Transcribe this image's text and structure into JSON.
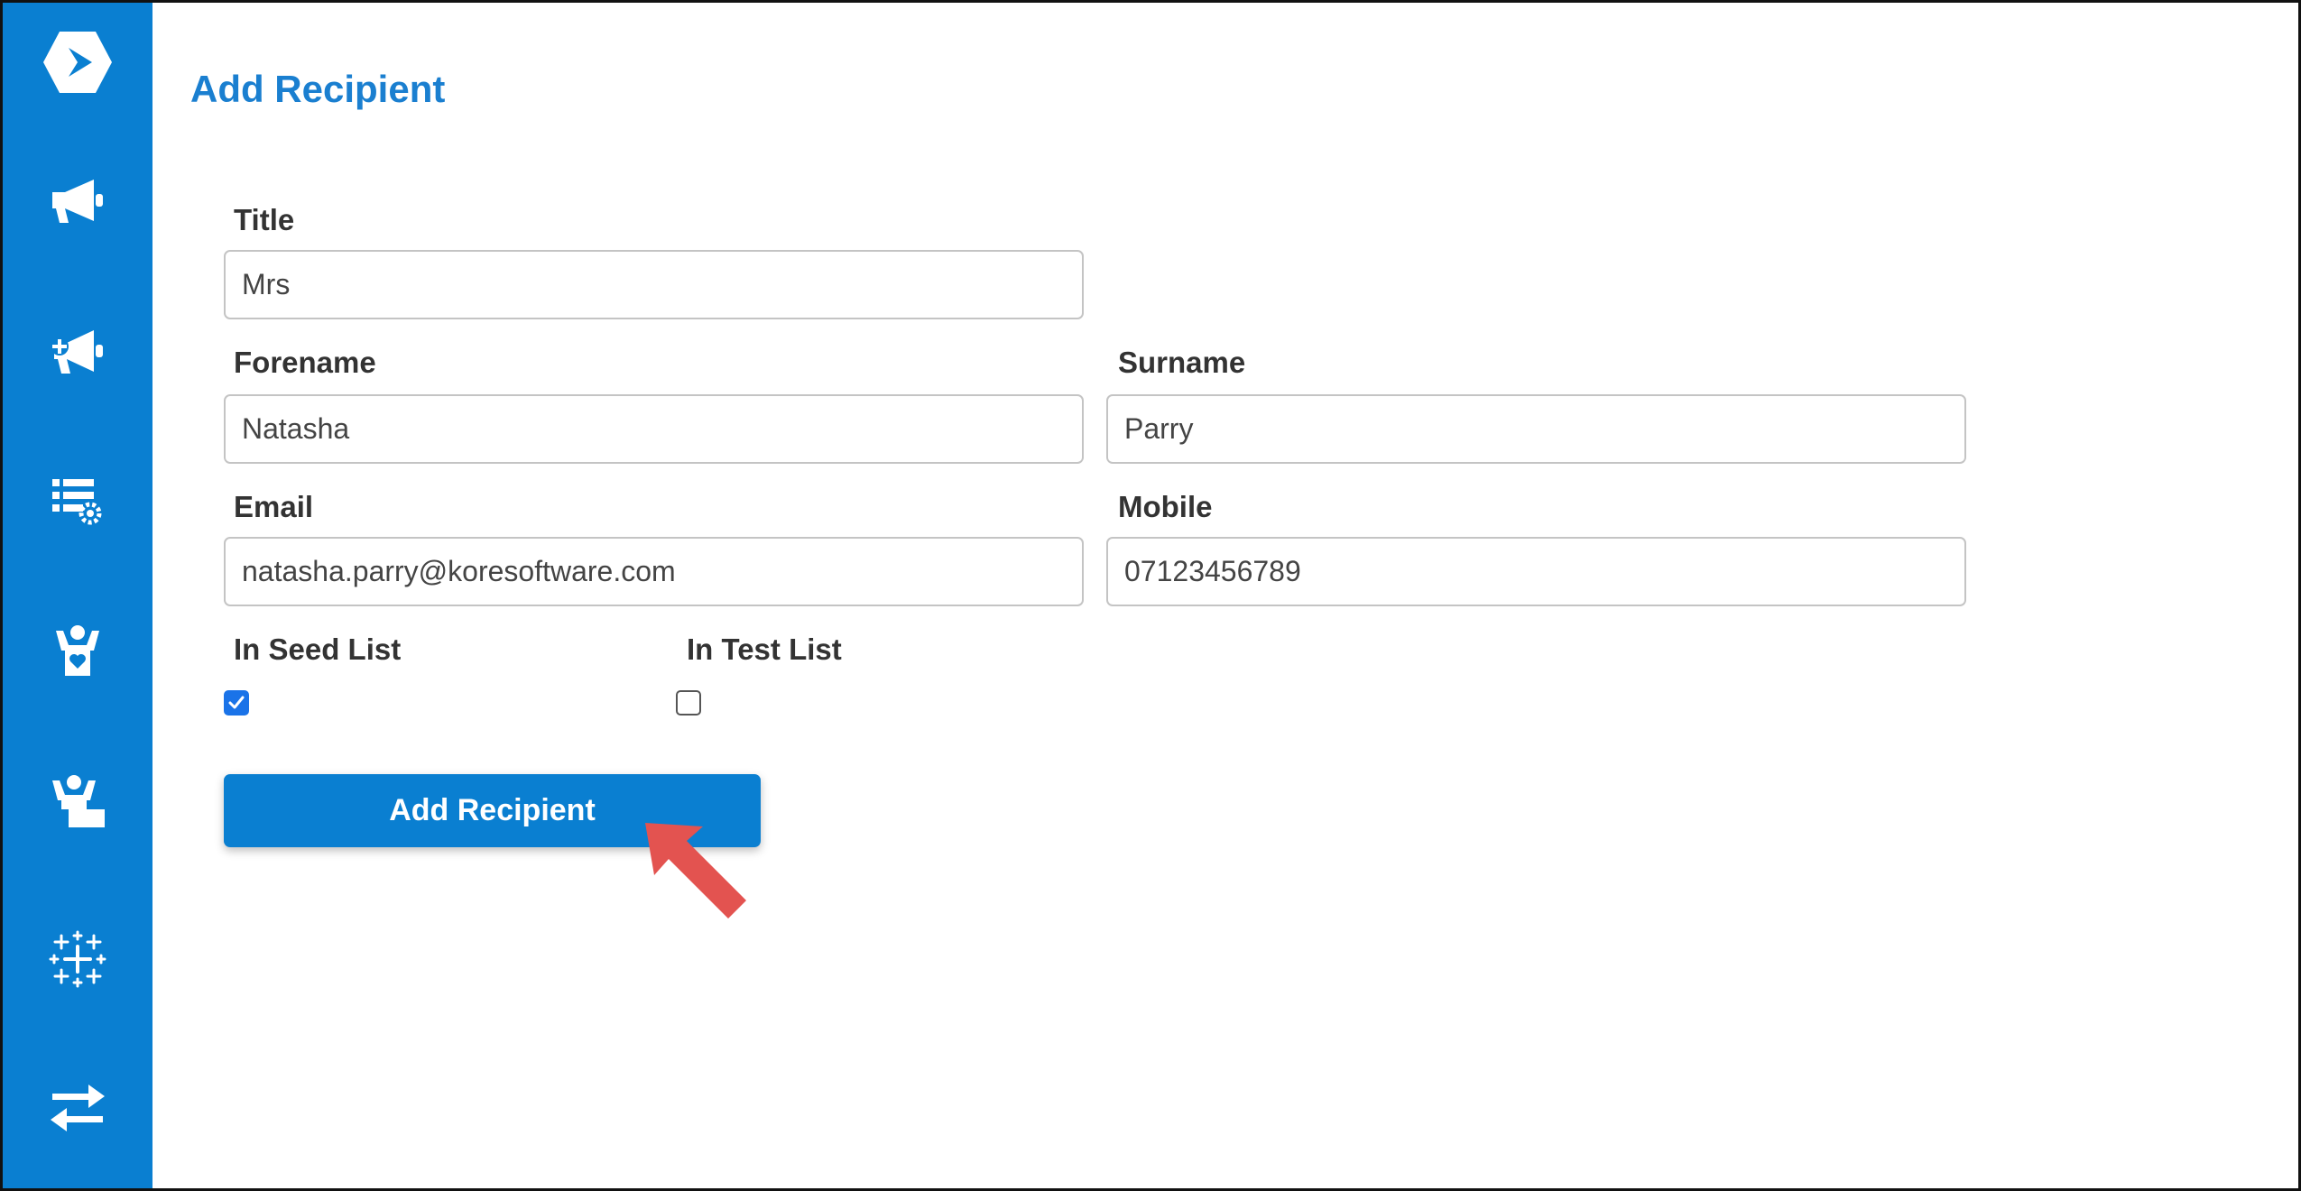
{
  "sidebar": {
    "items": [
      {
        "icon": "kore-logo-icon"
      },
      {
        "icon": "megaphone-icon"
      },
      {
        "icon": "megaphone-add-icon"
      },
      {
        "icon": "list-settings-icon"
      },
      {
        "icon": "person-heart-icon"
      },
      {
        "icon": "person-desk-icon"
      },
      {
        "icon": "tableau-icon"
      },
      {
        "icon": "swap-arrows-icon"
      }
    ]
  },
  "page": {
    "title": "Add Recipient"
  },
  "form": {
    "title": {
      "label": "Title",
      "value": "Mrs"
    },
    "forename": {
      "label": "Forename",
      "value": "Natasha"
    },
    "surname": {
      "label": "Surname",
      "value": "Parry"
    },
    "email": {
      "label": "Email",
      "value": "natasha.parry@koresoftware.com"
    },
    "mobile": {
      "label": "Mobile",
      "value": "07123456789"
    },
    "seed_list": {
      "label": "In Seed List",
      "checked": true
    },
    "test_list": {
      "label": "In Test List",
      "checked": false
    },
    "submit_label": "Add Recipient"
  },
  "colors": {
    "sidebar": "#0a7fd1",
    "title": "#1a7fd0",
    "button": "#0a7fd1",
    "annotation_arrow": "#e35350"
  }
}
